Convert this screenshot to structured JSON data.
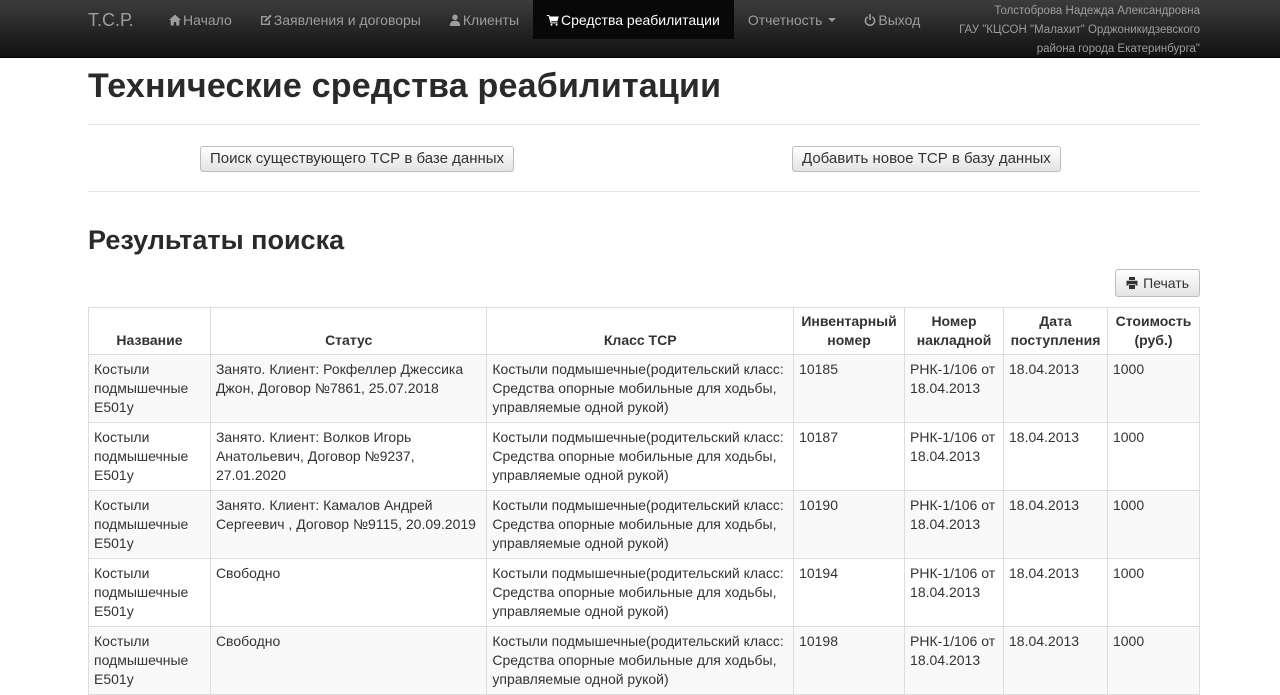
{
  "navbar": {
    "brand": "Т.С.Р.",
    "items": [
      {
        "label": "Начало",
        "icon": "home-icon"
      },
      {
        "label": "Заявления и договоры",
        "icon": "edit-icon"
      },
      {
        "label": "Клиенты",
        "icon": "user-icon"
      },
      {
        "label": "Средства реабилитации",
        "icon": "cart-icon"
      },
      {
        "label": "Отчетность",
        "icon": "caret-down-icon"
      },
      {
        "label": "Выход",
        "icon": "power-icon"
      }
    ],
    "active_label": "Средства реабилитации",
    "user": {
      "line1": "Толстоброва Надежда Александровна",
      "line2": "ГАУ \"КЦСОН \"Малахит\" Орджоникидзевского",
      "line3": "района города Екатеринбурга\""
    }
  },
  "page": {
    "title": "Технические средства реабилитации",
    "search_button": "Поиск существующего ТСР в базе данных",
    "add_button": "Добавить новое ТСР в базу данных",
    "results_title": "Результаты поиска",
    "print_button": "Печать"
  },
  "table": {
    "headers": {
      "name": "Название",
      "status": "Статус",
      "class": "Класс ТСР",
      "inv_line1": "Инвентарный",
      "inv_line2": "номер",
      "invoice_line1": "Номер",
      "invoice_line2": "накладной",
      "date_line1": "Дата",
      "date_line2": "поступления",
      "cost_line1": "Стоимость",
      "cost_line2": "(руб.)"
    },
    "rows": [
      {
        "name": "Костыли подмышечные E501у",
        "status": "Занято. Клиент: Рокфеллер Джессика Джон, Договор №7861, 25.07.2018",
        "class": "Костыли подмышечные(родительский класс: Средства опорные мобильные для ходьбы, управляемые одной рукой)",
        "inventory": "10185",
        "invoice": "РНК-1/106 от 18.04.2013",
        "date": "18.04.2013",
        "cost": "1000"
      },
      {
        "name": "Костыли подмышечные E501у",
        "status": "Занято. Клиент: Волков Игорь Анатольевич, Договор №9237, 27.01.2020",
        "class": "Костыли подмышечные(родительский класс: Средства опорные мобильные для ходьбы, управляемые одной рукой)",
        "inventory": "10187",
        "invoice": "РНК-1/106 от 18.04.2013",
        "date": "18.04.2013",
        "cost": "1000"
      },
      {
        "name": "Костыли подмышечные E501у",
        "status": "Занято. Клиент: Камалов Андрей Сергеевич , Договор №9115, 20.09.2019",
        "class": "Костыли подмышечные(родительский класс: Средства опорные мобильные для ходьбы, управляемые одной рукой)",
        "inventory": "10190",
        "invoice": "РНК-1/106 от 18.04.2013",
        "date": "18.04.2013",
        "cost": "1000"
      },
      {
        "name": "Костыли подмышечные E501у",
        "status": "Свободно",
        "class": "Костыли подмышечные(родительский класс: Средства опорные мобильные для ходьбы, управляемые одной рукой)",
        "inventory": "10194",
        "invoice": "РНК-1/106 от 18.04.2013",
        "date": "18.04.2013",
        "cost": "1000"
      },
      {
        "name": "Костыли подмышечные E501у",
        "status": "Свободно",
        "class": "Костыли подмышечные(родительский класс: Средства опорные мобильные для ходьбы, управляемые одной рукой)",
        "inventory": "10198",
        "invoice": "РНК-1/106 от 18.04.2013",
        "date": "18.04.2013",
        "cost": "1000"
      }
    ]
  }
}
